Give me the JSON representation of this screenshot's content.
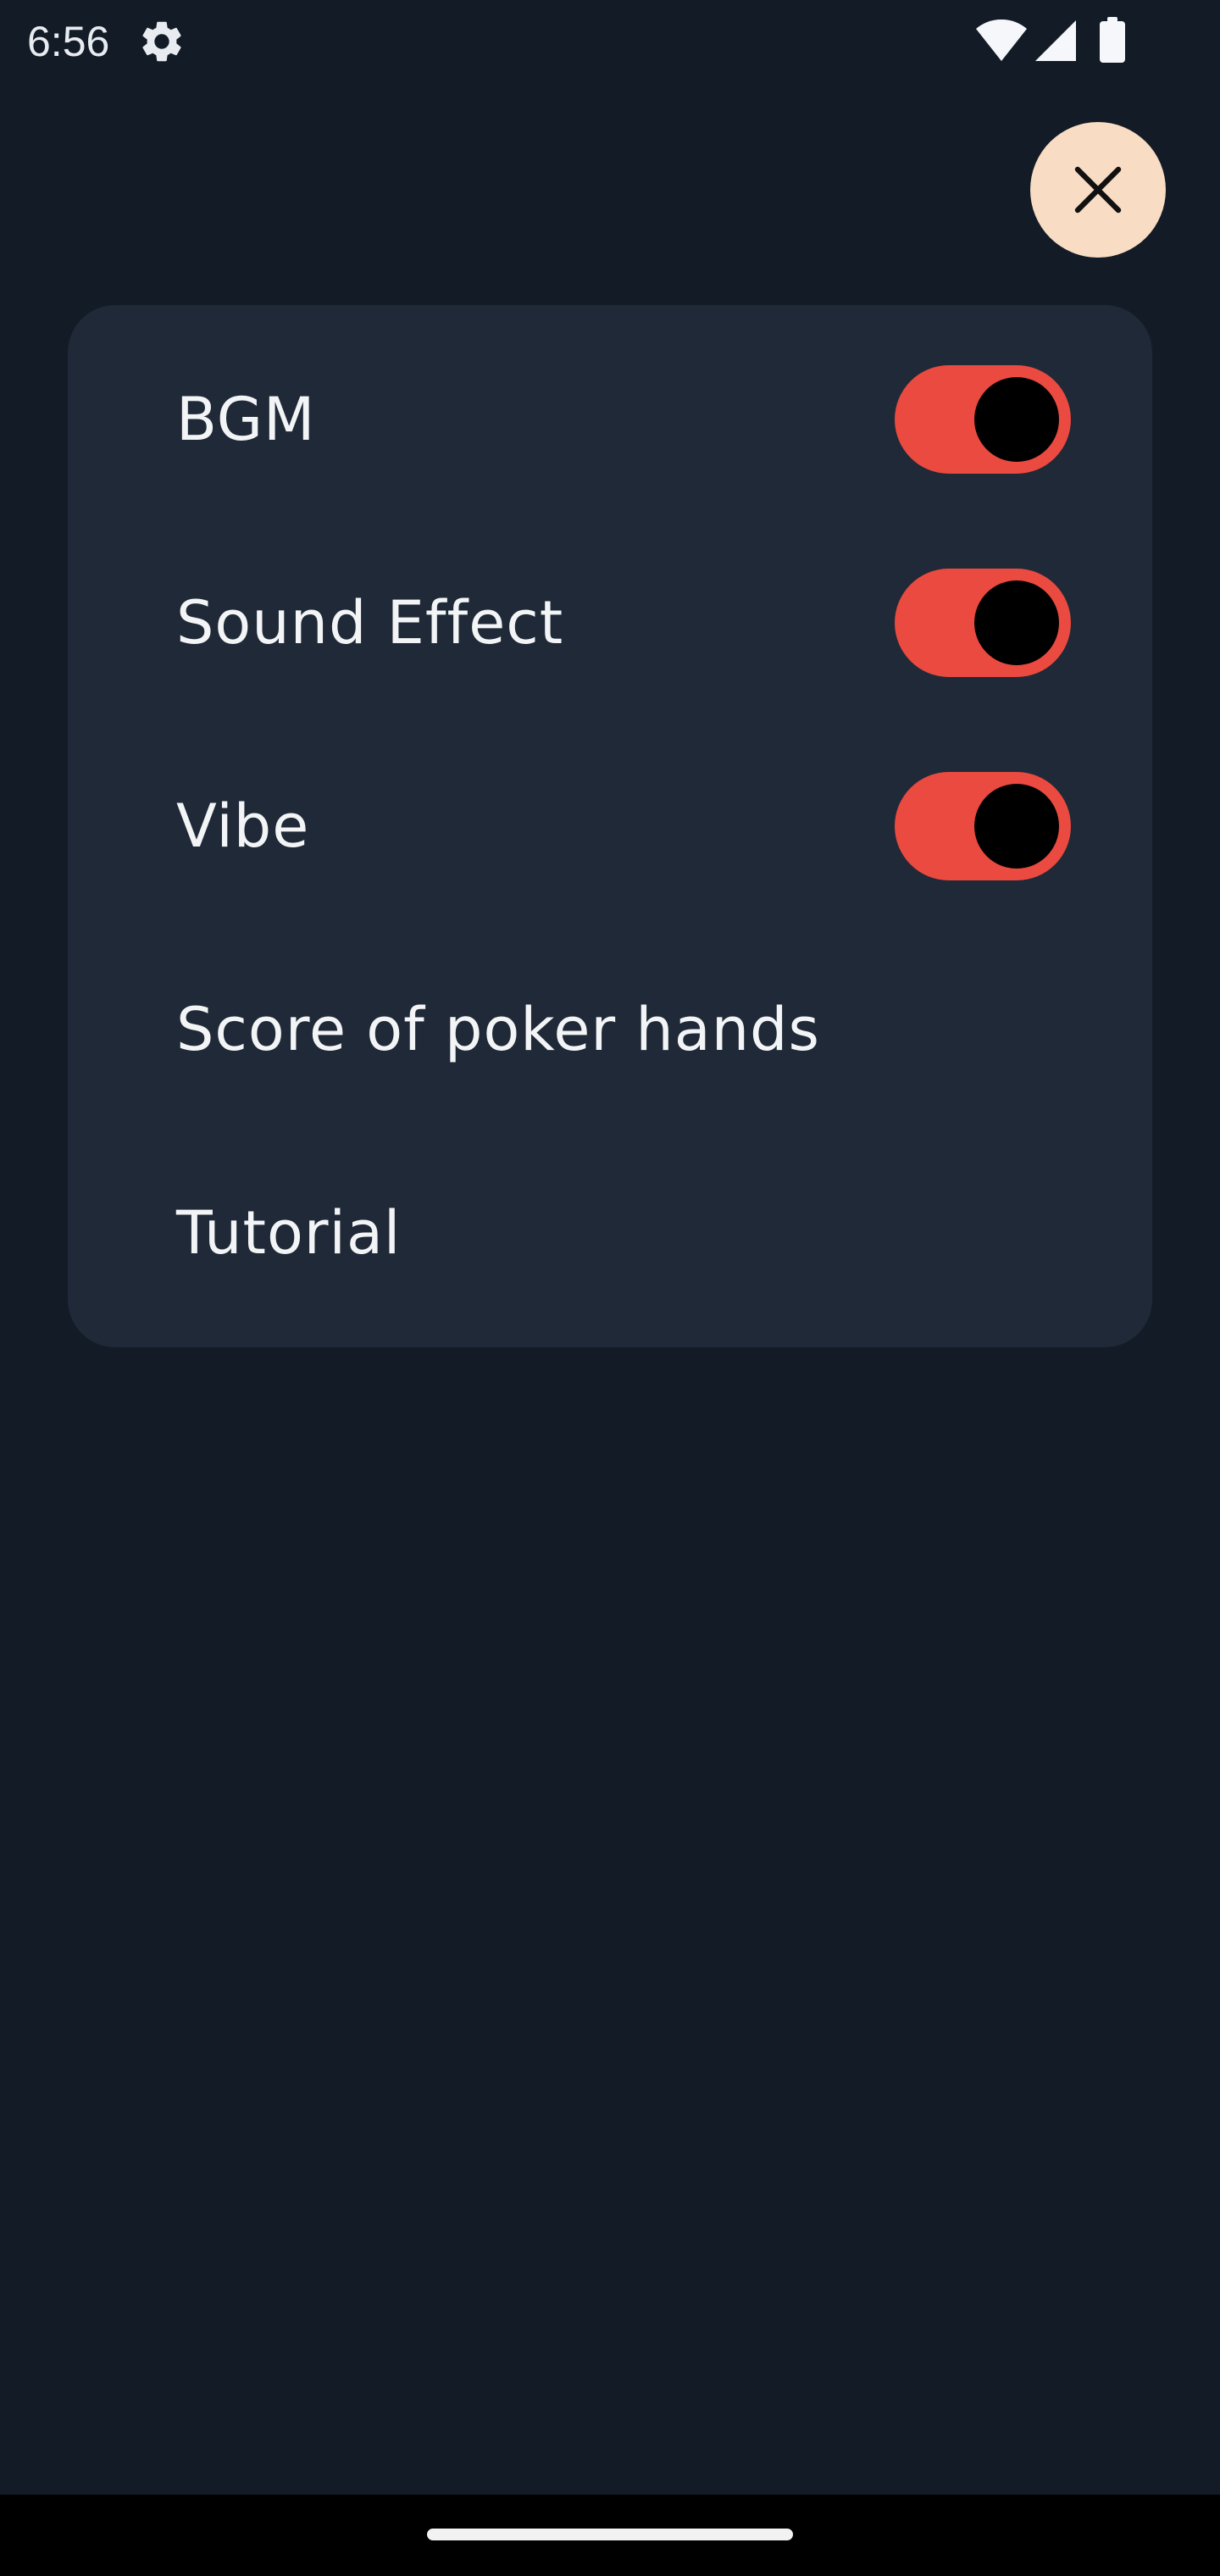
{
  "status_bar": {
    "time": "6:56",
    "icons": [
      "gear-icon",
      "wifi-icon",
      "signal-icon",
      "battery-icon"
    ]
  },
  "close_button": {
    "icon": "close-icon",
    "background_color": "#f8dcc3"
  },
  "settings": {
    "items": [
      {
        "label": "BGM",
        "toggle": true,
        "enabled": true
      },
      {
        "label": "Sound Effect",
        "toggle": true,
        "enabled": true
      },
      {
        "label": "Vibe",
        "toggle": true,
        "enabled": true
      },
      {
        "label": "Score of poker hands",
        "toggle": false
      },
      {
        "label": "Tutorial",
        "toggle": false
      }
    ]
  },
  "colors": {
    "background": "#131b26",
    "card": "#1f2937",
    "toggle_on": "#ea4a3f",
    "toggle_knob": "#000000",
    "text": "#f3f4f6"
  }
}
